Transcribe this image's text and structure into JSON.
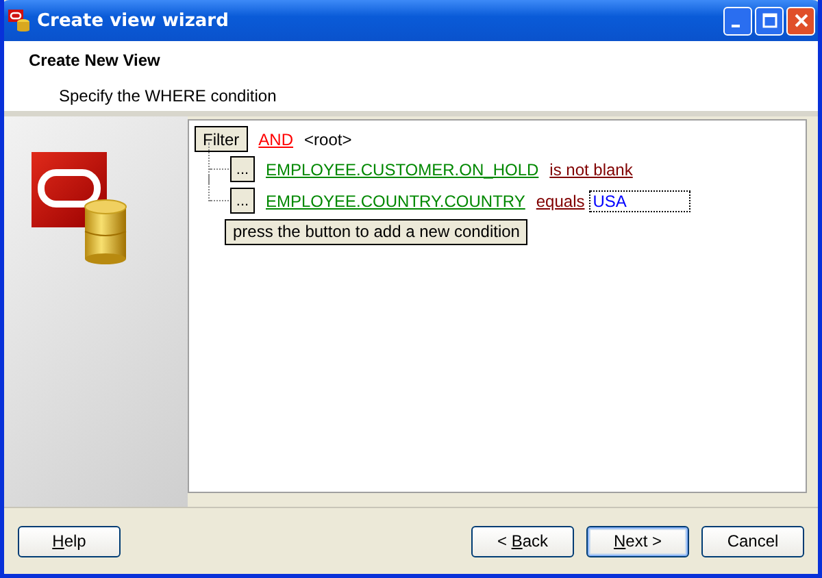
{
  "window": {
    "title": "Create view wizard"
  },
  "header": {
    "title": "Create New View",
    "subtitle": "Specify the WHERE condition"
  },
  "filter": {
    "button": "Filter",
    "operator": "AND",
    "node": "<root>",
    "conditions": [
      {
        "button": "...",
        "field": "EMPLOYEE.CUSTOMER.ON_HOLD",
        "operator": "is not blank"
      },
      {
        "button": "...",
        "field": "EMPLOYEE.COUNTRY.COUNTRY",
        "operator": "equals",
        "value": "USA"
      }
    ],
    "add_button": "press the button to add a new condition"
  },
  "left_buttons": [
    {
      "access_key": "H",
      "after": "elp",
      "default": false
    }
  ],
  "right_buttons": [
    {
      "before": "< ",
      "access_key": "B",
      "after": "ack",
      "default": false
    },
    {
      "access_key": "N",
      "after": "ext >",
      "default": true
    },
    {
      "before": "Cancel",
      "default": false
    }
  ]
}
